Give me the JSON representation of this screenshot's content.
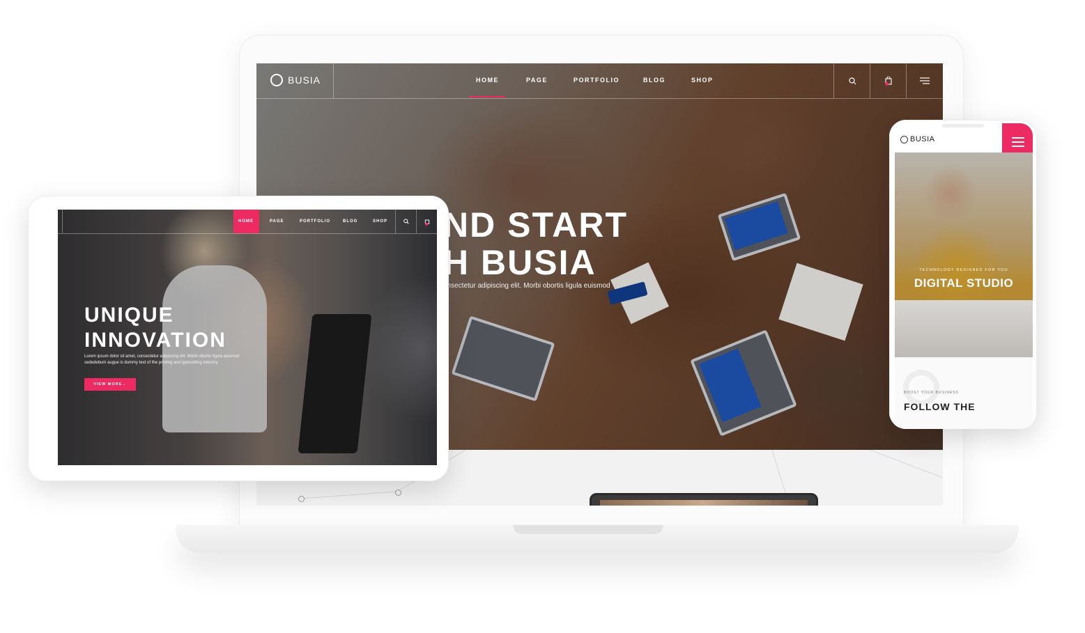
{
  "colors": {
    "accent": "#ee2a63",
    "nav_text": "#ffffff",
    "text_dark": "#222222"
  },
  "laptop": {
    "logo_text": "BUSIA",
    "nav": {
      "home": "HOME",
      "page": "PAGE",
      "portfolio": "PORTFOLIO",
      "blog": "BLOG",
      "shop": "SHOP"
    },
    "icons": {
      "search": "search-icon",
      "cart": "cart-icon",
      "menu": "hamburger-menu-icon"
    },
    "hero": {
      "heading": "ND START\nH BUSIA",
      "subtext": "onsectetur adipiscing elit. Morbi obortis ligula euismod"
    }
  },
  "tablet": {
    "nav": {
      "home": "HOME",
      "page": "PAGE",
      "portfolio": "PORTFOLIO",
      "blog": "BLOG",
      "shop": "SHOP"
    },
    "hero": {
      "heading": "UNIQUE\nINNOVATION",
      "subtext": "Lorem ipsum dolor sit amet, consectetur adipiscing elit. Morbi obortis ligula euismod sededebum augue is dummy text of the printing and typesetting industry.",
      "button": "VIEW MORE→"
    }
  },
  "phone": {
    "logo_text": "BUSIA",
    "hero": {
      "tagline": "TECHNOLOGY DESIGNED FOR YOU",
      "title": "DIGITAL STUDIO"
    },
    "section": {
      "kicker": "BOOST YOUR BUSINESS",
      "heading": "FOLLOW THE"
    }
  }
}
